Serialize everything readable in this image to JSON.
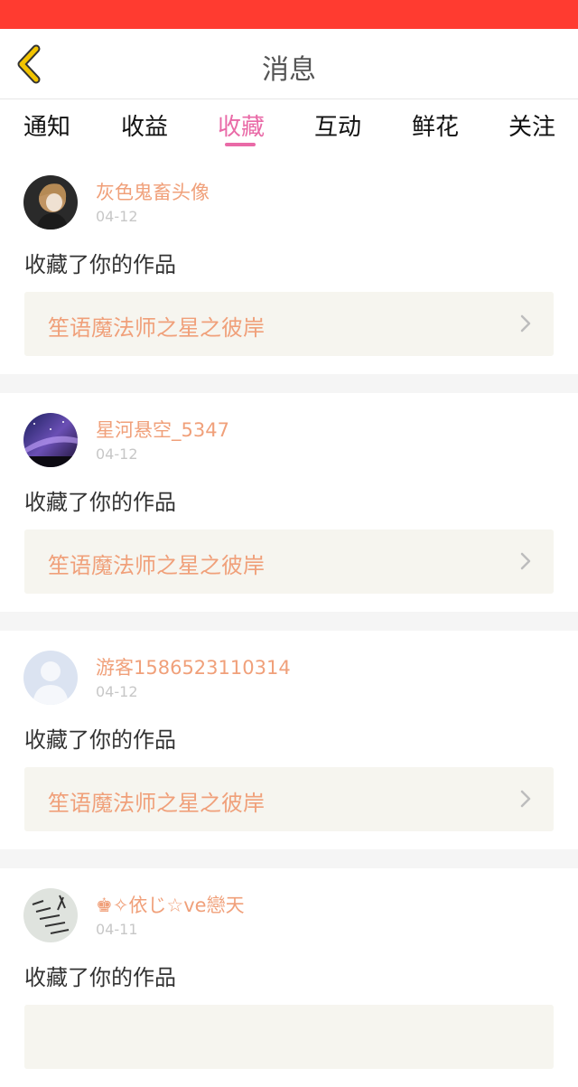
{
  "header": {
    "title": "消息"
  },
  "tabs": [
    {
      "label": "通知",
      "active": false
    },
    {
      "label": "收益",
      "active": false
    },
    {
      "label": "收藏",
      "active": true
    },
    {
      "label": "互动",
      "active": false
    },
    {
      "label": "鲜花",
      "active": false
    },
    {
      "label": "关注",
      "active": false
    }
  ],
  "colors": {
    "status_bar": "#ff3b30",
    "accent_pink": "#e96aa7",
    "username_orange": "#f0a07a",
    "card_bg": "#f6f5ef",
    "back_icon": "#f2c400"
  },
  "messages": [
    {
      "username": "灰色鬼畜头像",
      "date": "04-12",
      "action": "收藏了你的作品",
      "work_title": "笙语魔法师之星之彼岸",
      "avatar_icon": "anime-character-avatar"
    },
    {
      "username": "星河悬空_5347",
      "date": "04-12",
      "action": "收藏了你的作品",
      "work_title": "笙语魔法师之星之彼岸",
      "avatar_icon": "galaxy-avatar"
    },
    {
      "username": "游客1586523110314",
      "date": "04-12",
      "action": "收藏了你的作品",
      "work_title": "笙语魔法师之星之彼岸",
      "avatar_icon": "default-person-avatar"
    },
    {
      "username": "♚✧依じ☆ve戀天",
      "date": "04-11",
      "action": "收藏了你的作品",
      "work_title": "",
      "avatar_icon": "handwriting-avatar"
    }
  ]
}
